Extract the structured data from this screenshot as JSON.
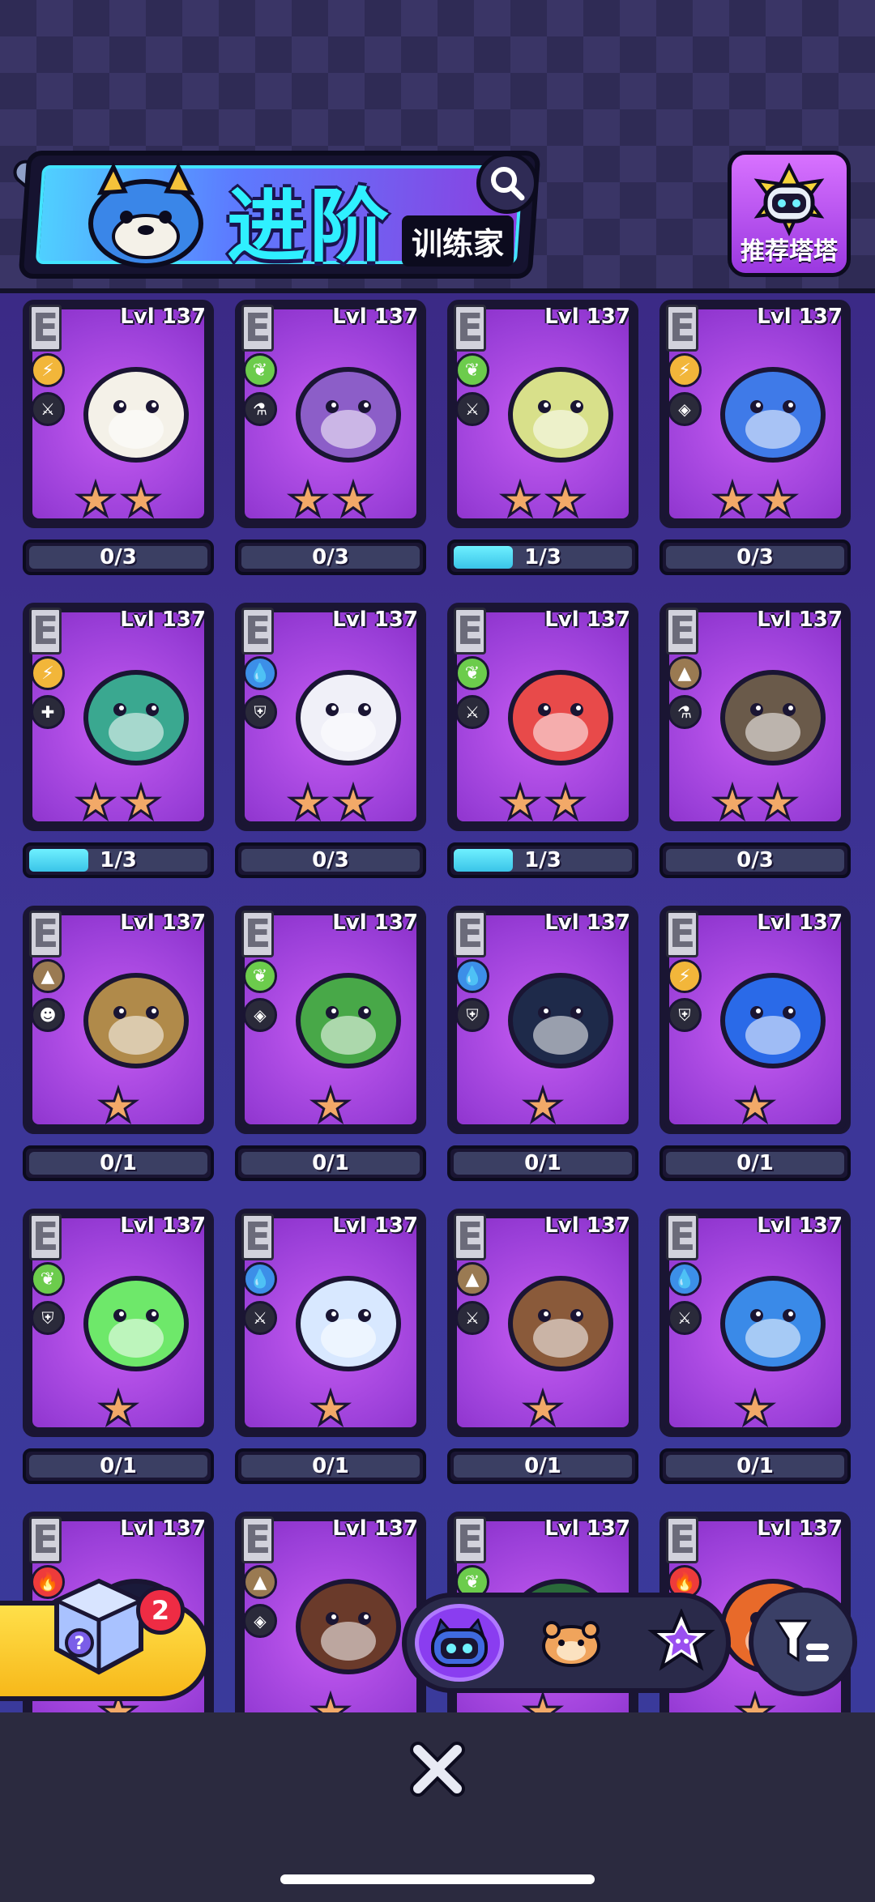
{
  "header": {
    "title": "进阶",
    "subtitle": "训练家",
    "recommend_label": "推荐塔塔"
  },
  "cards": [
    {
      "rarity": "E",
      "level": "Lvl 137",
      "element": "lightning",
      "class": "sword",
      "stars": 2,
      "progress": "0/3",
      "progress_fraction": 0.0,
      "creature": "orca-pet"
    },
    {
      "rarity": "E",
      "level": "Lvl 137",
      "element": "leaf",
      "class": "flask",
      "stars": 2,
      "progress": "0/3",
      "progress_fraction": 0.0,
      "creature": "mushroom-pet"
    },
    {
      "rarity": "E",
      "level": "Lvl 137",
      "element": "leaf",
      "class": "sword",
      "stars": 2,
      "progress": "1/3",
      "progress_fraction": 0.3333,
      "creature": "pear-bird-pet"
    },
    {
      "rarity": "E",
      "level": "Lvl 137",
      "element": "lightning",
      "class": "eye",
      "stars": 2,
      "progress": "0/3",
      "progress_fraction": 0.0,
      "creature": "blue-bat-pet"
    },
    {
      "rarity": "E",
      "level": "Lvl 137",
      "element": "lightning",
      "class": "cross",
      "stars": 2,
      "progress": "1/3",
      "progress_fraction": 0.3333,
      "creature": "moth-pet"
    },
    {
      "rarity": "E",
      "level": "Lvl 137",
      "element": "water",
      "class": "shield",
      "stars": 2,
      "progress": "0/3",
      "progress_fraction": 0.0,
      "creature": "polar-bear-pet"
    },
    {
      "rarity": "E",
      "level": "Lvl 137",
      "element": "leaf",
      "class": "sword",
      "stars": 2,
      "progress": "1/3",
      "progress_fraction": 0.3333,
      "creature": "flower-bud-pet"
    },
    {
      "rarity": "E",
      "level": "Lvl 137",
      "element": "earth",
      "class": "flask",
      "stars": 2,
      "progress": "0/3",
      "progress_fraction": 0.0,
      "creature": "raccoon-pet"
    },
    {
      "rarity": "E",
      "level": "Lvl 137",
      "element": "earth",
      "class": "head",
      "stars": 1,
      "progress": "0/1",
      "progress_fraction": 0.0,
      "creature": "turtle-pet"
    },
    {
      "rarity": "E",
      "level": "Lvl 137",
      "element": "leaf",
      "class": "eye",
      "stars": 1,
      "progress": "0/1",
      "progress_fraction": 0.0,
      "creature": "leaf-bird-pet"
    },
    {
      "rarity": "E",
      "level": "Lvl 137",
      "element": "water",
      "class": "shield",
      "stars": 1,
      "progress": "0/1",
      "progress_fraction": 0.0,
      "creature": "penguin-pet"
    },
    {
      "rarity": "E",
      "level": "Lvl 137",
      "element": "lightning",
      "class": "shield",
      "stars": 1,
      "progress": "0/1",
      "progress_fraction": 0.0,
      "creature": "toucan-pet"
    },
    {
      "rarity": "E",
      "level": "Lvl 137",
      "element": "leaf",
      "class": "shield",
      "stars": 1,
      "progress": "0/1",
      "progress_fraction": 0.0,
      "creature": "jelly-pet"
    },
    {
      "rarity": "E",
      "level": "Lvl 137",
      "element": "water",
      "class": "sword",
      "stars": 1,
      "progress": "0/1",
      "progress_fraction": 0.0,
      "creature": "jellyfish-pet"
    },
    {
      "rarity": "E",
      "level": "Lvl 137",
      "element": "earth",
      "class": "sword",
      "stars": 1,
      "progress": "0/1",
      "progress_fraction": 0.0,
      "creature": "weasel-pet"
    },
    {
      "rarity": "E",
      "level": "Lvl 137",
      "element": "water",
      "class": "sword",
      "stars": 1,
      "progress": "0/1",
      "progress_fraction": 0.0,
      "creature": "octopus-pet"
    },
    {
      "rarity": "E",
      "level": "Lvl 137",
      "element": "fire",
      "class": "",
      "stars": 1,
      "progress": "",
      "progress_fraction": 0.0,
      "creature": "cat-pet"
    },
    {
      "rarity": "E",
      "level": "Lvl 137",
      "element": "earth",
      "class": "eye",
      "stars": 1,
      "progress": "",
      "progress_fraction": 0.0,
      "creature": "boar-pet"
    },
    {
      "rarity": "E",
      "level": "Lvl 137",
      "element": "leaf",
      "class": "",
      "stars": 1,
      "progress": "",
      "progress_fraction": 0.0,
      "creature": "green-cat-pet"
    },
    {
      "rarity": "E",
      "level": "Lvl 137",
      "element": "fire",
      "class": "",
      "stars": 1,
      "progress": "",
      "progress_fraction": 0.0,
      "creature": "fox-pet"
    }
  ],
  "mystery_box": {
    "badge_count": "2"
  },
  "tabs": [
    {
      "name": "robot-cat-tab",
      "active": true
    },
    {
      "name": "hamster-tab",
      "active": false
    },
    {
      "name": "star-cat-tab",
      "active": false
    }
  ],
  "colors": {
    "lightning": "#f2b63a",
    "leaf": "#6ccc4c",
    "water": "#3c8fe8",
    "earth": "#9a7a52",
    "fire": "#ee3b3b",
    "progress_fill": "#4fd8f0",
    "card_bg": "#b14ee8"
  }
}
